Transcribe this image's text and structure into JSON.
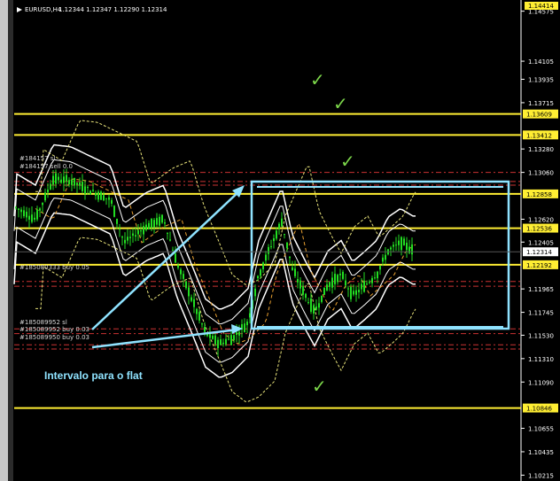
{
  "header": {
    "symbol": "EURUSD,H4",
    "ohlc": "1.12344 1.12347 1.12290 1.12314",
    "top_right_price": "1.14414"
  },
  "axis": {
    "ticks": [
      "1.14575",
      "1.14105",
      "1.13935",
      "1.13715",
      "1.13280",
      "1.13060",
      "1.12620",
      "1.12405",
      "1.11965",
      "1.11745",
      "1.11530",
      "1.11310",
      "1.11090",
      "1.10655",
      "1.10435",
      "1.10215"
    ],
    "tick_values": [
      1.14575,
      1.14105,
      1.13935,
      1.13715,
      1.1328,
      1.1306,
      1.1262,
      1.12405,
      1.11965,
      1.11745,
      1.1153,
      1.1131,
      1.1109,
      1.10655,
      1.10435,
      1.10215
    ],
    "current_price": "1.12314",
    "ymin": 1.1016,
    "ymax": 1.1468
  },
  "levels": [
    {
      "label": "1.13609",
      "value": 1.13609
    },
    {
      "label": "1.13412",
      "value": 1.13412
    },
    {
      "label": "1.12858",
      "value": 1.12858
    },
    {
      "label": "1.12536",
      "value": 1.12536
    },
    {
      "label": "1.12192",
      "value": 1.12192
    },
    {
      "label": "1.10846",
      "value": 1.10846
    }
  ],
  "trades": [
    {
      "id": "#184157",
      "text": "#184157 sl"
    },
    {
      "id": "#184157b",
      "text": "#184157 sell 0.0"
    },
    {
      "id": "#185080333",
      "text": "#185080333 buy 0.05"
    },
    {
      "id": "#185089952a",
      "text": "#185089952 sl"
    },
    {
      "id": "#185089952b",
      "text": "#185089952 buy 0.03"
    },
    {
      "id": "#185089950",
      "text": "#185089950 buy 0.03"
    }
  ],
  "annotation": {
    "label": "Intervalo para o flat",
    "check_mark": "✓"
  },
  "colors": {
    "level_line": "#ffee33",
    "level_label_bg": "#ffee33",
    "candle": "#22dd22",
    "box": "#8fe3ff",
    "bollinger": "#ffffff",
    "envelope": "#e8e37a",
    "ma": "#e8a030",
    "trade_line": "#cc3333",
    "check": "#7cd64a"
  },
  "icons": [
    "check-icon"
  ]
}
